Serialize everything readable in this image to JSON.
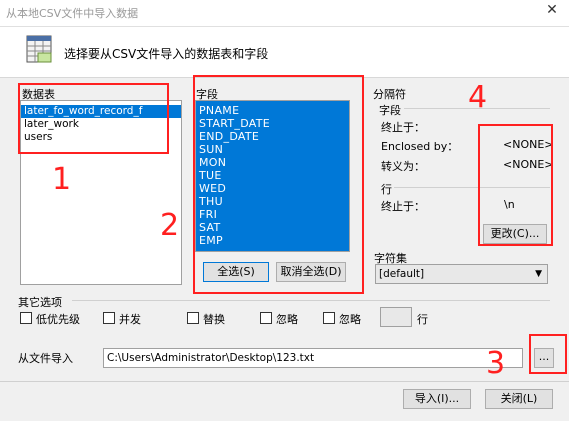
{
  "window": {
    "title": "从本地CSV文件中导入数据",
    "close_glyph": "✕"
  },
  "header": {
    "icon": "csv-table-icon",
    "text": "选择要从CSV文件导入的数据表和字段"
  },
  "tables": {
    "label": "数据表",
    "items": [
      "later_fo_word_record_f",
      "later_work",
      "users"
    ],
    "selected": 0
  },
  "fields": {
    "label": "字段",
    "items": [
      "PNAME",
      "START_DATE",
      "END_DATE",
      "SUN",
      "MON",
      "TUE",
      "WED",
      "THU",
      "FRI",
      "SAT",
      "EMP"
    ],
    "select_all": "全选(S)",
    "deselect_all": "取消全选(D)"
  },
  "separator": {
    "label": "分隔符",
    "field_label": "字段",
    "terminated_label": "终止于：",
    "terminated_value": "",
    "enclosed_label": "Enclosed by：",
    "enclosed_value": "<NONE>",
    "escaped_label": "转义为：",
    "escaped_value": "<NONE>",
    "line_label": "行",
    "line_terminated_label": "终止于：",
    "line_terminated_value": "\\n",
    "change_button": "更改(C)..."
  },
  "charset": {
    "label": "字符集",
    "value": "[default]"
  },
  "other_options": {
    "label": "其它选项",
    "low_priority": "低优先级",
    "concurrent": "并发",
    "replace": "替换",
    "ignore1": "忽略",
    "ignore2": "忽略",
    "rows": "行"
  },
  "file": {
    "label": "从文件导入",
    "path": "C:\\Users\\Administrator\\Desktop\\123.txt",
    "browse": "..."
  },
  "footer": {
    "import": "导入(I)...",
    "close": "关闭(L)"
  },
  "annotations": {
    "n1": "1",
    "n2": "2",
    "n3": "3",
    "n4": "4"
  },
  "colors": {
    "selection": "#0078d7",
    "annotation": "#ff2020"
  }
}
